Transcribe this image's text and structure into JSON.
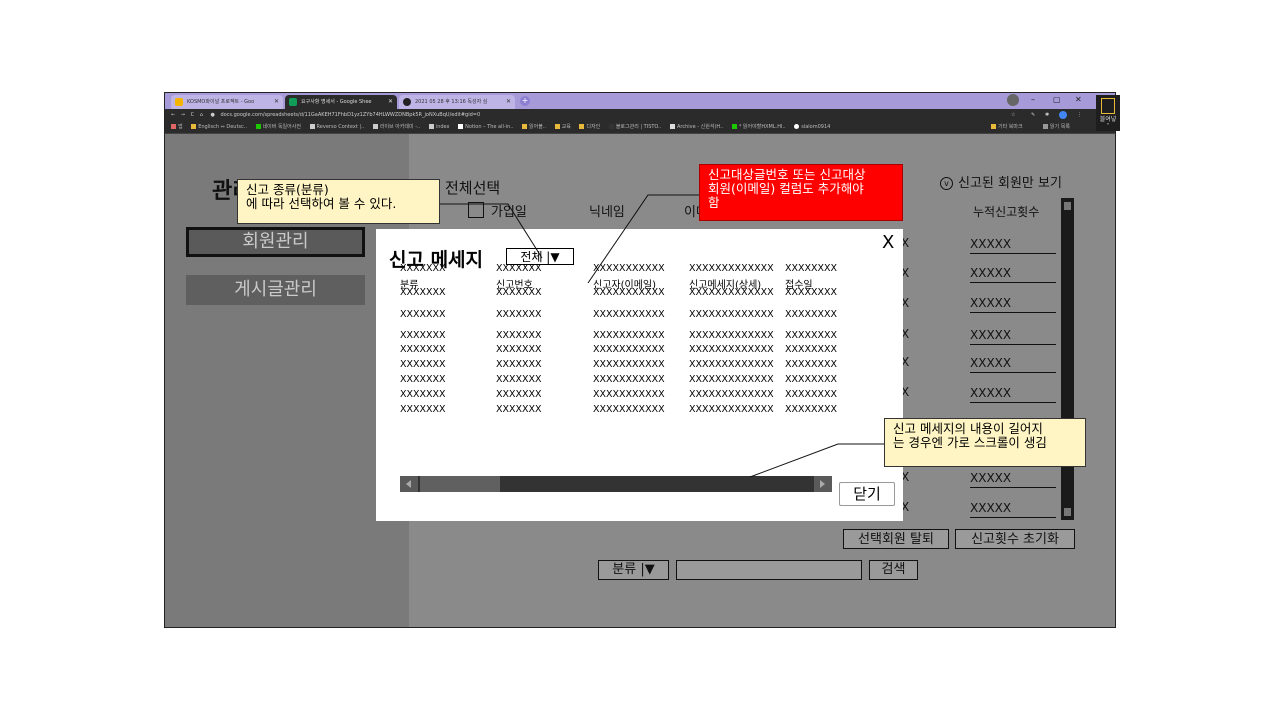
{
  "browser": {
    "tabs": [
      {
        "label": "KOSMO파이널 프로젝트 - Goo"
      },
      {
        "label": "요구사항 명세서 - Google Shee"
      },
      {
        "label": "2021 05 28 후 13:16 독성자 심"
      }
    ],
    "url": "docs.google.com/spreadsheets/d/11GaAKEH71FhbD1yz1ZYb74HLWWZDNBpk5R_joNXuBqU/edit#gid=0",
    "bookmarks": [
      "앱",
      "Englisch ⇔ Deutsc..",
      "네이버 독일어사전",
      "Reverso Context |..",
      "라이브 아카데미 -..",
      "index",
      "Notion – The all-in..",
      "읽어볼..",
      "교육",
      "디자인",
      "블로그관리 | TISTO..",
      "Archive - 신원석(H..",
      "* 읽어야할HXML.HI..",
      "slalom0914",
      "기타 북마크",
      "읽기 목록"
    ],
    "side_label": "블여넣"
  },
  "page": {
    "admin_title": "관리자 페이지",
    "nav": {
      "members": "회원관리",
      "posts": "게시글관리"
    },
    "select_all": "전체선택",
    "columns": {
      "join_date": "가입일",
      "nickname": "닉네임",
      "email": "이메"
    },
    "reported_only": "신고된 회원만 보기",
    "cumulative_header": "누적신고횟수",
    "bg_rows": [
      "XXXXX",
      "XXXXX",
      "XXXXX",
      "XXXXX",
      "XXXXX",
      "XXXXX",
      "XXXXX",
      "XXXXX",
      "XXXXX",
      "XXXXX"
    ],
    "bg_cut": "X",
    "actions": {
      "withdraw": "선택회원 탈퇴",
      "reset": "신고횟수 초기화"
    },
    "search": {
      "filter": "분류 |▼",
      "placeholder": "",
      "button": "검색"
    }
  },
  "modal": {
    "title": "신고 메세지",
    "filter": "전체 |▼",
    "close_x": "X",
    "headers": [
      "분류",
      "신고번호",
      "신고자(이메일)",
      "신고메세지(상세)",
      "접수일"
    ],
    "rows": [
      [
        "XXXXXXX",
        "XXXXXXX",
        "XXXXXXXXXXX",
        "XXXXXXXXXXXXX",
        "XXXXXXXX"
      ],
      [
        "XXXXXXX",
        "XXXXXXX",
        "XXXXXXXXXXX",
        "XXXXXXXXXXXXX",
        "XXXXXXXX"
      ],
      [
        "XXXXXXX",
        "XXXXXXX",
        "XXXXXXXXXXX",
        "XXXXXXXXXXXXX",
        "XXXXXXXX"
      ],
      [
        "XXXXXXX",
        "XXXXXXX",
        "XXXXXXXXXXX",
        "XXXXXXXXXXXXX",
        "XXXXXXXX"
      ],
      [
        "XXXXXXX",
        "XXXXXXX",
        "XXXXXXXXXXX",
        "XXXXXXXXXXXXX",
        "XXXXXXXX"
      ],
      [
        "XXXXXXX",
        "XXXXXXX",
        "XXXXXXXXXXX",
        "XXXXXXXXXXXXX",
        "XXXXXXXX"
      ],
      [
        "XXXXXXX",
        "XXXXXXX",
        "XXXXXXXXXXX",
        "XXXXXXXXXXXXX",
        "XXXXXXXX"
      ],
      [
        "XXXXXXX",
        "XXXXXXX",
        "XXXXXXXXXXX",
        "XXXXXXXXXXXXX",
        "XXXXXXXX"
      ],
      [
        "XXXXXXX",
        "XXXXXXX",
        "XXXXXXXXXXX",
        "XXXXXXXXXXXXX",
        "XXXXXXXX"
      ]
    ],
    "close_button": "닫기"
  },
  "callouts": {
    "filter_note": "신고 종류(분류)\n에 따라 선택하여 볼 수 있다.",
    "column_note": "신고대상글번호 또는 신고대상\n회원(이메일) 컬럼도 추가해야\n함",
    "scroll_note": "신고 메세지의 내용이 길어지\n는 경우엔 가로 스크롤이 생김"
  },
  "colors": {
    "tabbar": "#a79ad9",
    "chrome_dark": "#2b2b2b",
    "overlay_gray": "#8a8a8a",
    "callout_yellow": "#fff5c4",
    "callout_red": "#ff0000"
  }
}
